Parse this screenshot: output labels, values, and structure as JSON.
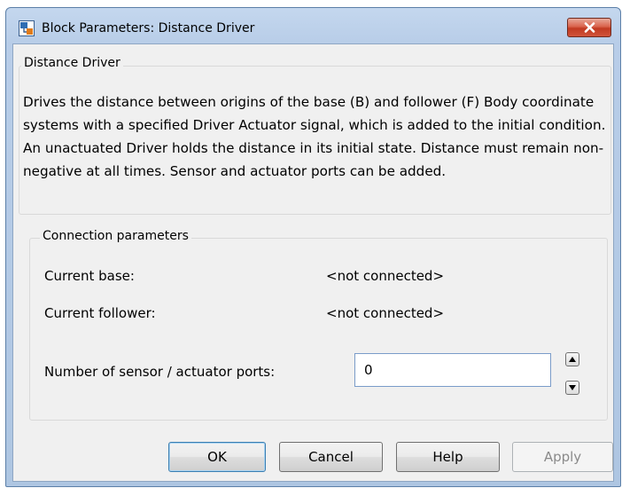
{
  "window": {
    "title": "Block Parameters: Distance Driver"
  },
  "description_group": {
    "title": "Distance Driver",
    "text": "Drives the distance between origins of the base (B) and follower (F) Body coordinate systems with a specified Driver Actuator signal, which is added to the initial condition. An unactuated Driver holds the distance in its initial state. Distance must remain non-negative at all times. Sensor and actuator ports can be added."
  },
  "connection": {
    "title": "Connection parameters",
    "base_label": "Current base:",
    "base_value": "<not connected>",
    "follower_label": "Current follower:",
    "follower_value": "<not connected>",
    "ports_label": "Number of sensor / actuator ports:",
    "ports_value": "0"
  },
  "buttons": {
    "ok": "OK",
    "cancel": "Cancel",
    "help": "Help",
    "apply": "Apply"
  },
  "icons": {
    "window_icon": "simulink-block-icon",
    "close": "close-icon",
    "spin_up": "spin-up-icon",
    "spin_down": "spin-down-icon"
  },
  "colors": {
    "titlebar": "#b8cde8",
    "close_button": "#c8452d",
    "dialog_background": "#f0f0f0"
  }
}
